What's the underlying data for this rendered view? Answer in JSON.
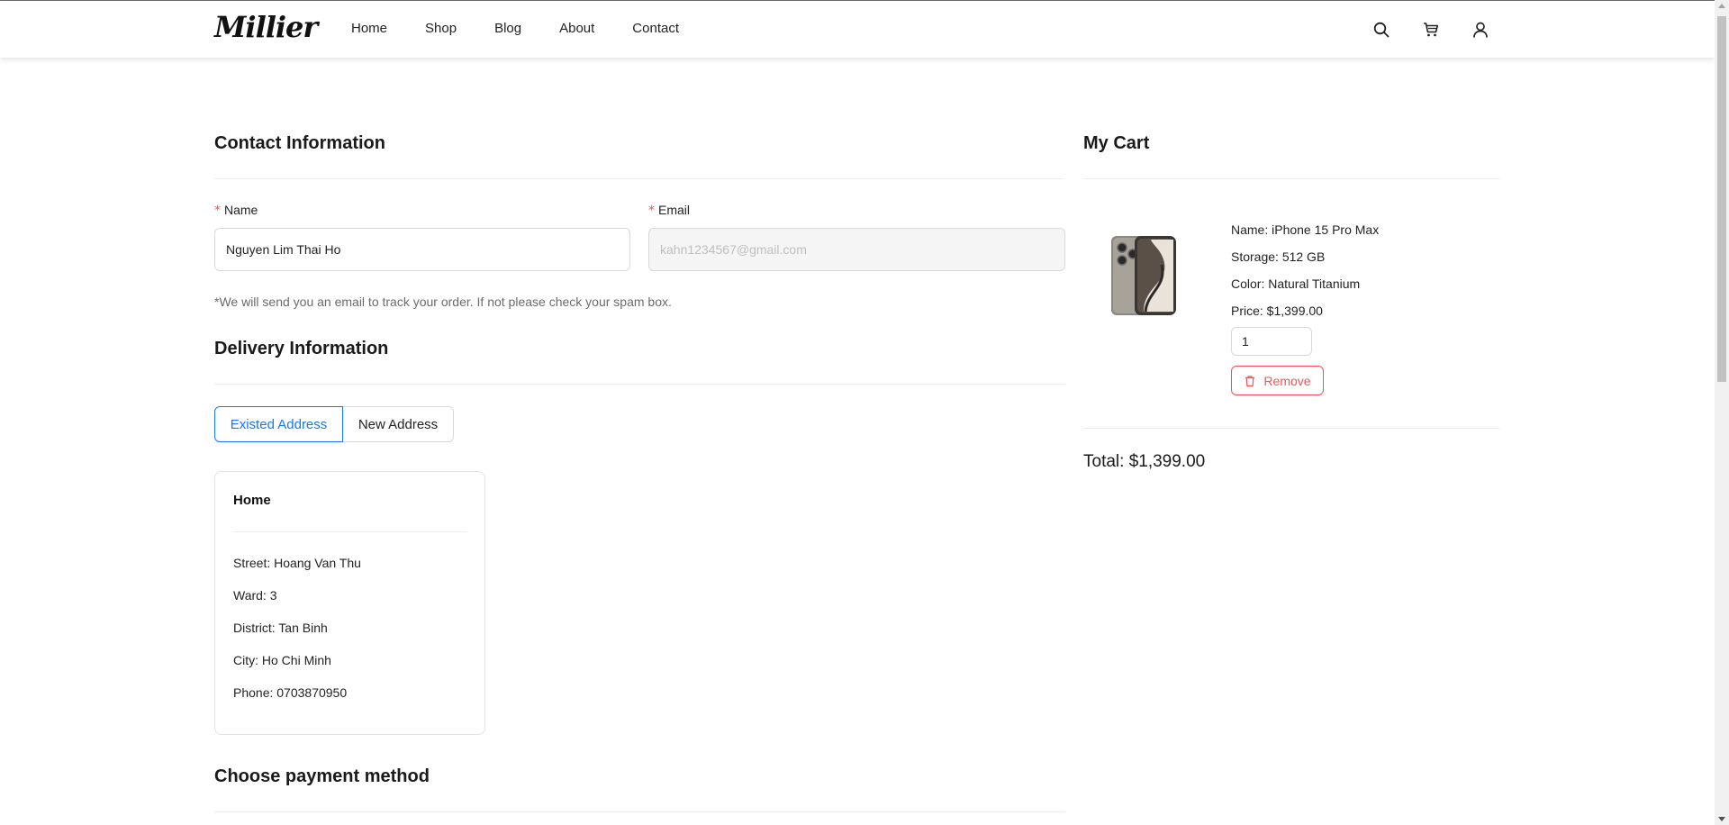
{
  "header": {
    "logo": "Millier",
    "nav": [
      "Home",
      "Shop",
      "Blog",
      "About",
      "Contact"
    ],
    "icons": [
      "search-icon",
      "cart-icon",
      "user-icon"
    ]
  },
  "contact": {
    "title": "Contact Information",
    "name_label": "Name",
    "name_value": "Nguyen Lim Thai Ho",
    "email_label": "Email",
    "email_value": "kahn1234567@gmail.com",
    "required_mark": "*",
    "note": "*We will send you an email to track your order. If not please check your spam box."
  },
  "delivery": {
    "title": "Delivery Information",
    "tabs": [
      "Existed Address",
      "New Address"
    ],
    "active_tab": "Existed Address",
    "address": {
      "title": "Home",
      "street": "Street: Hoang Van Thu",
      "ward": "Ward: 3",
      "district": "District: Tan Binh",
      "city": "City: Ho Chi Minh",
      "phone": "Phone: 0703870950"
    }
  },
  "payment": {
    "title": "Choose payment method"
  },
  "cart": {
    "title": "My Cart",
    "item": {
      "name": "Name: iPhone 15 Pro Max",
      "storage": "Storage: 512 GB",
      "color": "Color: Natural Titanium",
      "price": "Price: $1,399.00",
      "quantity": "1",
      "remove_label": "Remove"
    },
    "total": "Total: $1,399.00"
  },
  "colors": {
    "primary": "#1677ff",
    "danger": "#ff4d4f",
    "border": "#d9d9d9"
  }
}
